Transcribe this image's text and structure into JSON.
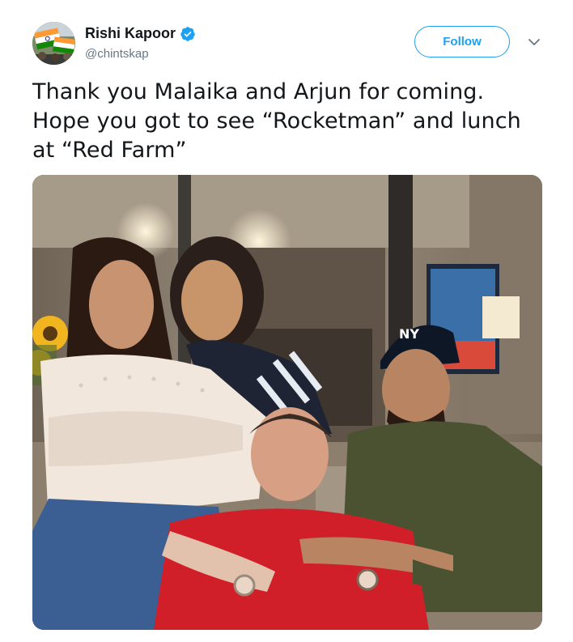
{
  "tweet": {
    "author": {
      "display_name": "Rishi Kapoor",
      "handle": "@chintskap",
      "verified": true,
      "avatar_icon": "flag-avatar-icon"
    },
    "follow_label": "Follow",
    "menu_icon": "chevron-down-icon",
    "text_lines": [
      "Thank you Malaika and Arjun for coming.",
      "Hope you got to see “Rocketman” and lunch",
      "at “Red Farm”"
    ],
    "photo_icon": "group-photo-icon"
  },
  "colors": {
    "accent": "#1da1f2",
    "text_primary": "#14171a",
    "text_secondary": "#657786"
  }
}
